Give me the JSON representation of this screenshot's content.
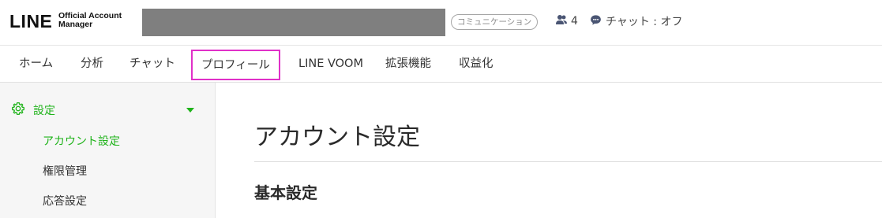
{
  "header": {
    "logo_text": "LINE",
    "logo_subtitle_line1": "Official Account",
    "logo_subtitle_line2": "Manager",
    "category_badge": "コミュニケーション",
    "friends_count": "4",
    "chat_status": "チャット : オフ"
  },
  "topnav": {
    "items": [
      {
        "label": "ホーム"
      },
      {
        "label": "分析"
      },
      {
        "label": "チャット"
      },
      {
        "label": "プロフィール"
      },
      {
        "label": "LINE VOOM"
      },
      {
        "label": "拡張機能"
      },
      {
        "label": "収益化"
      }
    ]
  },
  "sidebar": {
    "section_label": "設定",
    "items": [
      {
        "label": "アカウント設定"
      },
      {
        "label": "権限管理"
      },
      {
        "label": "応答設定"
      }
    ]
  },
  "main": {
    "page_title": "アカウント設定",
    "section_title": "基本設定"
  },
  "colors": {
    "accent_green": "#1fb31a",
    "highlight_magenta": "#e030c8",
    "redacted_gray": "#7f7f7f"
  },
  "icons": [
    "friends-icon",
    "chat-icon",
    "gear-icon",
    "caret-down-icon"
  ]
}
